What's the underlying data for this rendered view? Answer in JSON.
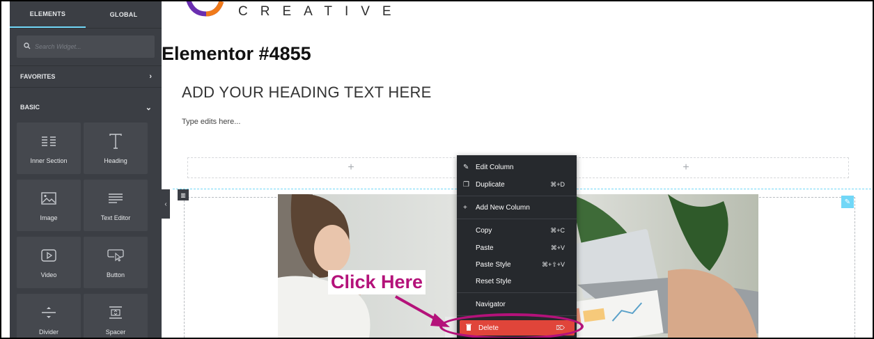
{
  "sidebar": {
    "tabs": [
      {
        "label": "ELEMENTS",
        "active": true
      },
      {
        "label": "GLOBAL",
        "active": false
      }
    ],
    "search_placeholder": "Search Widget...",
    "categories": {
      "favorites": "FAVORITES",
      "basic": "BASIC"
    },
    "widgets": [
      {
        "label": "Inner Section",
        "icon": "inner-section-icon"
      },
      {
        "label": "Heading",
        "icon": "heading-icon"
      },
      {
        "label": "Image",
        "icon": "image-icon"
      },
      {
        "label": "Text Editor",
        "icon": "text-editor-icon"
      },
      {
        "label": "Video",
        "icon": "video-icon"
      },
      {
        "label": "Button",
        "icon": "button-icon"
      },
      {
        "label": "Divider",
        "icon": "divider-icon"
      },
      {
        "label": "Spacer",
        "icon": "spacer-icon"
      }
    ]
  },
  "page": {
    "logo_text": "CREATIVE",
    "title": "Elementor #4855",
    "heading": "ADD YOUR HEADING TEXT HERE",
    "paragraph": "Type edits here..."
  },
  "context_menu": {
    "items": [
      {
        "label": "Edit Column",
        "shortcut": "",
        "icon": "pencil-icon"
      },
      {
        "label": "Duplicate",
        "shortcut": "⌘+D",
        "icon": "duplicate-icon"
      },
      {
        "label": "Add New Column",
        "shortcut": "",
        "icon": "plus-icon"
      },
      {
        "label": "Copy",
        "shortcut": "⌘+C",
        "icon": ""
      },
      {
        "label": "Paste",
        "shortcut": "⌘+V",
        "icon": ""
      },
      {
        "label": "Paste Style",
        "shortcut": "⌘+⇧+V",
        "icon": ""
      },
      {
        "label": "Reset Style",
        "shortcut": "",
        "icon": ""
      },
      {
        "label": "Navigator",
        "shortcut": "",
        "icon": ""
      },
      {
        "label": "Delete",
        "shortcut": "⌦",
        "icon": "trash-icon"
      }
    ]
  },
  "annotation": {
    "callout": "Click Here"
  },
  "colors": {
    "sidebar": "#3b3e44",
    "accent": "#71d7f7",
    "delete": "#e0453a",
    "callout": "#b4127a"
  }
}
